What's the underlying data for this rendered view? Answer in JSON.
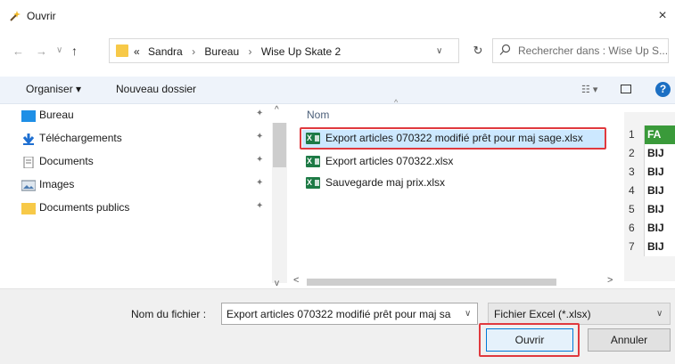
{
  "window": {
    "title": "Ouvrir",
    "close_glyph": "×"
  },
  "navigation": {
    "back_glyph": "←",
    "forward_glyph": "→",
    "history_glyph": "∨",
    "up_glyph": "↑",
    "refresh_glyph": "↻",
    "address": {
      "overflow": "«",
      "crumbs": [
        "Sandra",
        "Bureau",
        "Wise Up Skate 2"
      ],
      "separator": "›",
      "dropdown_glyph": "∨"
    },
    "search": {
      "icon": "search-icon",
      "placeholder": "Rechercher dans : Wise Up S..."
    }
  },
  "toolbar": {
    "organize_label": "Organiser ▾",
    "new_folder_label": "Nouveau dossier",
    "view_glyph": "☷ ▾",
    "help_glyph": "?"
  },
  "sidebar": {
    "items": [
      {
        "label": "Bureau",
        "icon": "desktop-icon",
        "pinned": true
      },
      {
        "label": "Téléchargements",
        "icon": "download-icon",
        "pinned": true
      },
      {
        "label": "Documents",
        "icon": "documents-icon",
        "pinned": true
      },
      {
        "label": "Images",
        "icon": "images-icon",
        "pinned": true
      },
      {
        "label": "Documents publics",
        "icon": "folder-icon",
        "pinned": true
      }
    ],
    "pin_glyph": "📌"
  },
  "file_list": {
    "column_header": "Nom",
    "sort_glyph": "^",
    "files": [
      {
        "name": "Export articles 070322 modifié prêt pour maj sage.xlsx",
        "selected": true
      },
      {
        "name": "Export articles 070322.xlsx",
        "selected": false
      },
      {
        "name": "Sauvegarde maj prix.xlsx",
        "selected": false
      }
    ],
    "icon_letter": "X"
  },
  "preview": {
    "rows": [
      {
        "num": "1",
        "cell": "FA"
      },
      {
        "num": "2",
        "cell": "BIJ"
      },
      {
        "num": "3",
        "cell": "BIJ"
      },
      {
        "num": "4",
        "cell": "BIJ"
      },
      {
        "num": "5",
        "cell": "BIJ"
      },
      {
        "num": "6",
        "cell": "BIJ"
      },
      {
        "num": "7",
        "cell": "BIJ"
      }
    ]
  },
  "footer": {
    "filename_label": "Nom du fichier :",
    "filename_value": "Export articles 070322 modifié prêt pour maj sa",
    "filetype_value": "Fichier Excel (*.xlsx)",
    "open_label": "Ouvrir",
    "cancel_label": "Annuler",
    "dropdown_glyph": "∨"
  },
  "colors": {
    "highlight_red": "#e0393e",
    "selection_blue": "#cce8ff",
    "excel_green": "#1d7a45",
    "accent_blue": "#0078d7"
  }
}
